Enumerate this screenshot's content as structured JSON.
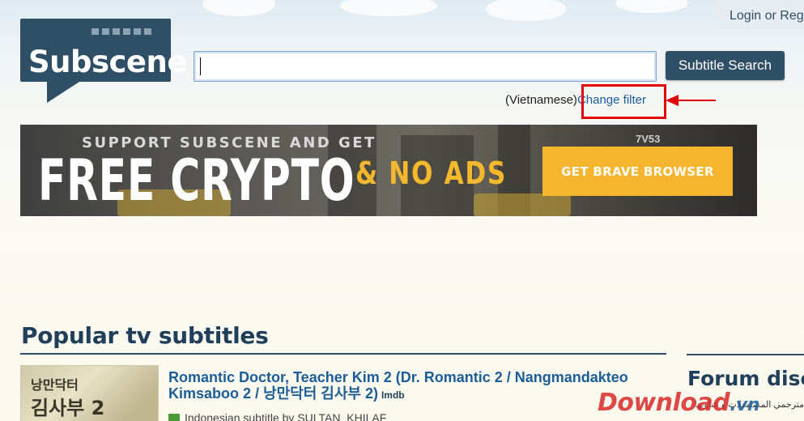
{
  "header": {
    "logo_text": "Subscene",
    "login_text": "Login or Reg",
    "search": {
      "value": "",
      "placeholder": ""
    },
    "search_button": "Subtitle Search",
    "filter": {
      "language": "(Vietnamese)",
      "change_link": "Change filter"
    }
  },
  "banner": {
    "headline_top": "SUPPORT SUBSCENE AND GET",
    "headline_main": "FREE CRYPTO",
    "headline_sub": "& NO ADS",
    "cta": "GET BRAVE BROWSER",
    "plate": "7V53"
  },
  "popular": {
    "title": "Popular tv subtitles",
    "items": [
      {
        "poster_text_line1": "낭만닥터",
        "poster_text_line2": "김사부 2",
        "title": "Romantic Doctor, Teacher Kim 2 (Dr. Romantic 2 / Nangmandakteo Kimsaboo 2 / 낭만닥터 김사부 2)",
        "imdb": "Imdb",
        "meta": "Indonesian subtitle by SULTAN_KHILAF"
      }
    ]
  },
  "forum": {
    "title": "Forum disc",
    "snippet": "مترجمي المسلسلات و عناويها"
  },
  "watermark": {
    "main": "Download",
    "tail": ".vn"
  },
  "colors": {
    "brand": "#2e4f66",
    "link": "#1a5d99",
    "highlight": "#e20000",
    "cta": "#f5b52e"
  }
}
